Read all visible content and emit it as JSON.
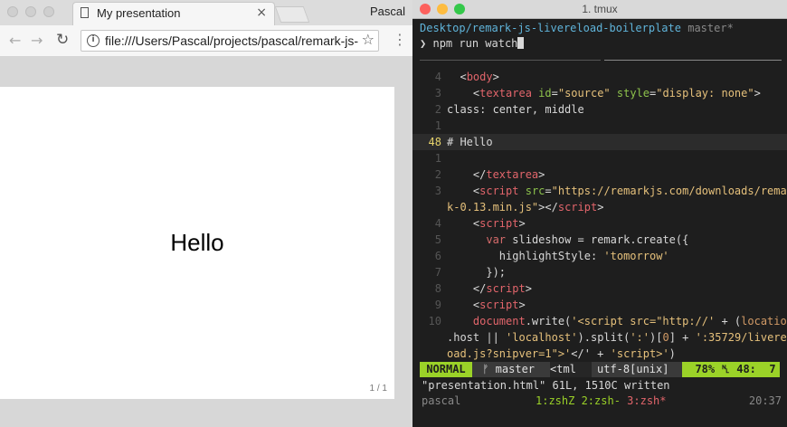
{
  "browser": {
    "tab_title": "My presentation",
    "tab_close": "×",
    "profile_name": "Pascal",
    "url": "file:///Users/Pascal/projects/pascal/remark-js-livereload-boilerplate/presentation.html",
    "info_glyph": "i",
    "back_glyph": "←",
    "forward_glyph": "→",
    "reload_glyph": "↻",
    "star_glyph": "☆",
    "menu_glyph": "⋮",
    "slide": {
      "heading": "Hello",
      "page_counter": "1 / 1"
    }
  },
  "terminal": {
    "window_title": "1. tmux",
    "cwd": "Desktop/remark-js-livereload-boilerplate",
    "git_branch": "master*",
    "prompt_glyph": "❯",
    "command": "npm run watch",
    "code_lines": [
      {
        "n": "4",
        "segs": [
          [
            "plain",
            "  <"
          ],
          [
            "tag",
            "body"
          ],
          [
            "plain",
            ">"
          ]
        ]
      },
      {
        "n": "3",
        "segs": [
          [
            "plain",
            "    <"
          ],
          [
            "tag",
            "textarea"
          ],
          [
            "plain",
            " "
          ],
          [
            "attr",
            "id"
          ],
          [
            "plain",
            "="
          ],
          [
            "str",
            "\"source\""
          ],
          [
            "plain",
            " "
          ],
          [
            "attr",
            "style"
          ],
          [
            "plain",
            "="
          ],
          [
            "str",
            "\"display: none\""
          ],
          [
            "plain",
            ">"
          ]
        ]
      },
      {
        "n": "2",
        "segs": [
          [
            "plain",
            "class: center, middle"
          ]
        ]
      },
      {
        "n": "1",
        "segs": [
          [
            "plain",
            ""
          ]
        ]
      },
      {
        "n": "48",
        "cur": true,
        "segs": [
          [
            "plain",
            "# Hello"
          ]
        ]
      },
      {
        "n": "1",
        "segs": [
          [
            "plain",
            ""
          ]
        ]
      },
      {
        "n": "2",
        "segs": [
          [
            "plain",
            "    </"
          ],
          [
            "tag",
            "textarea"
          ],
          [
            "plain",
            ">"
          ]
        ]
      },
      {
        "n": "3",
        "segs": [
          [
            "plain",
            "    <"
          ],
          [
            "tag",
            "script"
          ],
          [
            "plain",
            " "
          ],
          [
            "attr",
            "src"
          ],
          [
            "plain",
            "="
          ],
          [
            "str",
            "\"https://remarkjs.com/downloads/remar"
          ]
        ]
      },
      {
        "n": "",
        "segs": [
          [
            "str",
            "k-0.13.min.js\""
          ],
          [
            "plain",
            "></"
          ],
          [
            "tag",
            "script"
          ],
          [
            "plain",
            ">"
          ]
        ]
      },
      {
        "n": "4",
        "segs": [
          [
            "plain",
            "    <"
          ],
          [
            "tag",
            "script"
          ],
          [
            "plain",
            ">"
          ]
        ]
      },
      {
        "n": "5",
        "segs": [
          [
            "plain",
            "      "
          ],
          [
            "kw",
            "var"
          ],
          [
            "plain",
            " slideshow = remark.create({"
          ]
        ]
      },
      {
        "n": "6",
        "segs": [
          [
            "plain",
            "        highlightStyle: "
          ],
          [
            "str",
            "'tomorrow'"
          ]
        ]
      },
      {
        "n": "7",
        "segs": [
          [
            "plain",
            "      });"
          ]
        ]
      },
      {
        "n": "8",
        "segs": [
          [
            "plain",
            "    </"
          ],
          [
            "tag",
            "script"
          ],
          [
            "plain",
            ">"
          ]
        ]
      },
      {
        "n": "9",
        "segs": [
          [
            "plain",
            "    <"
          ],
          [
            "tag",
            "script"
          ],
          [
            "plain",
            ">"
          ]
        ]
      },
      {
        "n": "10",
        "segs": [
          [
            "plain",
            "    "
          ],
          [
            "tag",
            "document"
          ],
          [
            "plain",
            ".write("
          ],
          [
            "str",
            "'<script src=\"http://'"
          ],
          [
            "plain",
            " + ("
          ],
          [
            "num",
            "location"
          ]
        ]
      },
      {
        "n": "",
        "segs": [
          [
            "plain",
            ".host || "
          ],
          [
            "str",
            "'localhost'"
          ],
          [
            "plain",
            ").split("
          ],
          [
            "str",
            "':'"
          ],
          [
            "plain",
            ")["
          ],
          [
            "num",
            "0"
          ],
          [
            "plain",
            "] + "
          ],
          [
            "str",
            "':35729/liverel"
          ]
        ]
      },
      {
        "n": "",
        "segs": [
          [
            "str",
            "oad.js?snipver=1\">'"
          ],
          [
            "plain",
            "</"
          ],
          [
            "plain",
            "' + "
          ],
          [
            "str",
            "'script>'"
          ],
          [
            "plain",
            ")"
          ]
        ]
      }
    ],
    "statusline": {
      "mode": "NORMAL",
      "branch_glyph": "ᚠ",
      "branch": "master",
      "filetype": "<tml",
      "encoding": "utf-8[unix]",
      "percent": "78%",
      "line_glyph": "␤",
      "position": "48:  7"
    },
    "message": "\"presentation.html\" 61L, 1510C written",
    "tmux": {
      "session": "pascal",
      "windows_prefix": "1:zshZ 2:zsh- ",
      "active_window": "3:zsh*",
      "clock": "20:37"
    }
  },
  "colors": {
    "accent_green": "#9bd228",
    "tag_red": "#e2656b",
    "attr_green": "#8dc24c",
    "string_yellow": "#e5c07b",
    "path_blue": "#5fb3d9"
  }
}
